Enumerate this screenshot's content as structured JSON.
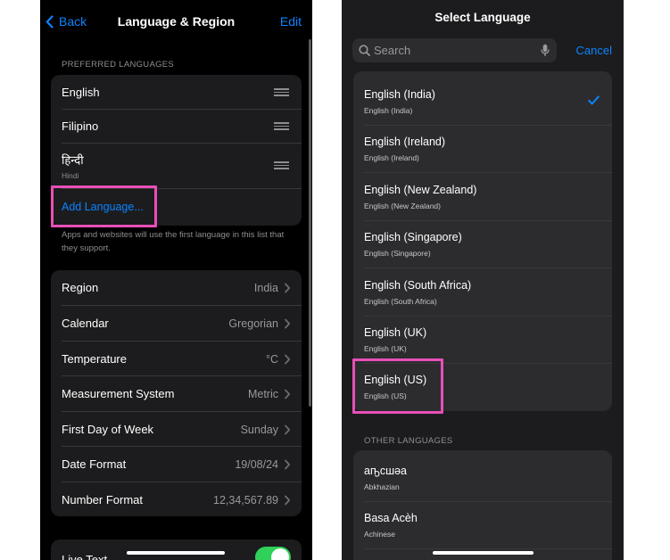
{
  "left": {
    "nav": {
      "back_label": "Back",
      "title": "Language & Region",
      "edit_label": "Edit"
    },
    "preferred_header": "PREFERRED LANGUAGES",
    "languages": [
      {
        "name": "English",
        "native": ""
      },
      {
        "name": "Filipino",
        "native": ""
      },
      {
        "name": "हिन्दी",
        "native": "Hindi"
      }
    ],
    "add_language": "Add Language...",
    "footer_note": "Apps and websites will use the first language in this list that they support.",
    "settings": [
      {
        "label": "Region",
        "value": "India"
      },
      {
        "label": "Calendar",
        "value": "Gregorian"
      },
      {
        "label": "Temperature",
        "value": "°C"
      },
      {
        "label": "Measurement System",
        "value": "Metric"
      },
      {
        "label": "First Day of Week",
        "value": "Sunday"
      },
      {
        "label": "Date Format",
        "value": "19/08/24"
      },
      {
        "label": "Number Format",
        "value": "12,34,567.89"
      }
    ],
    "live_text": {
      "label": "Live Text",
      "enabled": true
    }
  },
  "right": {
    "title": "Select Language",
    "search": {
      "placeholder": "Search",
      "value": ""
    },
    "cancel_label": "Cancel",
    "languages": [
      {
        "name": "English (India)",
        "native": "English (India)",
        "selected": true
      },
      {
        "name": "English (Ireland)",
        "native": "English (Ireland)",
        "selected": false
      },
      {
        "name": "English (New Zealand)",
        "native": "English (New Zealand)",
        "selected": false
      },
      {
        "name": "English (Singapore)",
        "native": "English (Singapore)",
        "selected": false
      },
      {
        "name": "English (South Africa)",
        "native": "English (South Africa)",
        "selected": false
      },
      {
        "name": "English (UK)",
        "native": "English (UK)",
        "selected": false
      },
      {
        "name": "English (US)",
        "native": "English (US)",
        "selected": false
      }
    ],
    "other_header": "OTHER LANGUAGES",
    "other_languages": [
      {
        "name": "аҧсшәа",
        "native": "Abkhazian"
      },
      {
        "name": "Basa Acèh",
        "native": "Achinese"
      }
    ]
  },
  "colors": {
    "accent": "#0a84ff",
    "highlight": "#e84fb8",
    "toggle_on": "#30d158"
  }
}
